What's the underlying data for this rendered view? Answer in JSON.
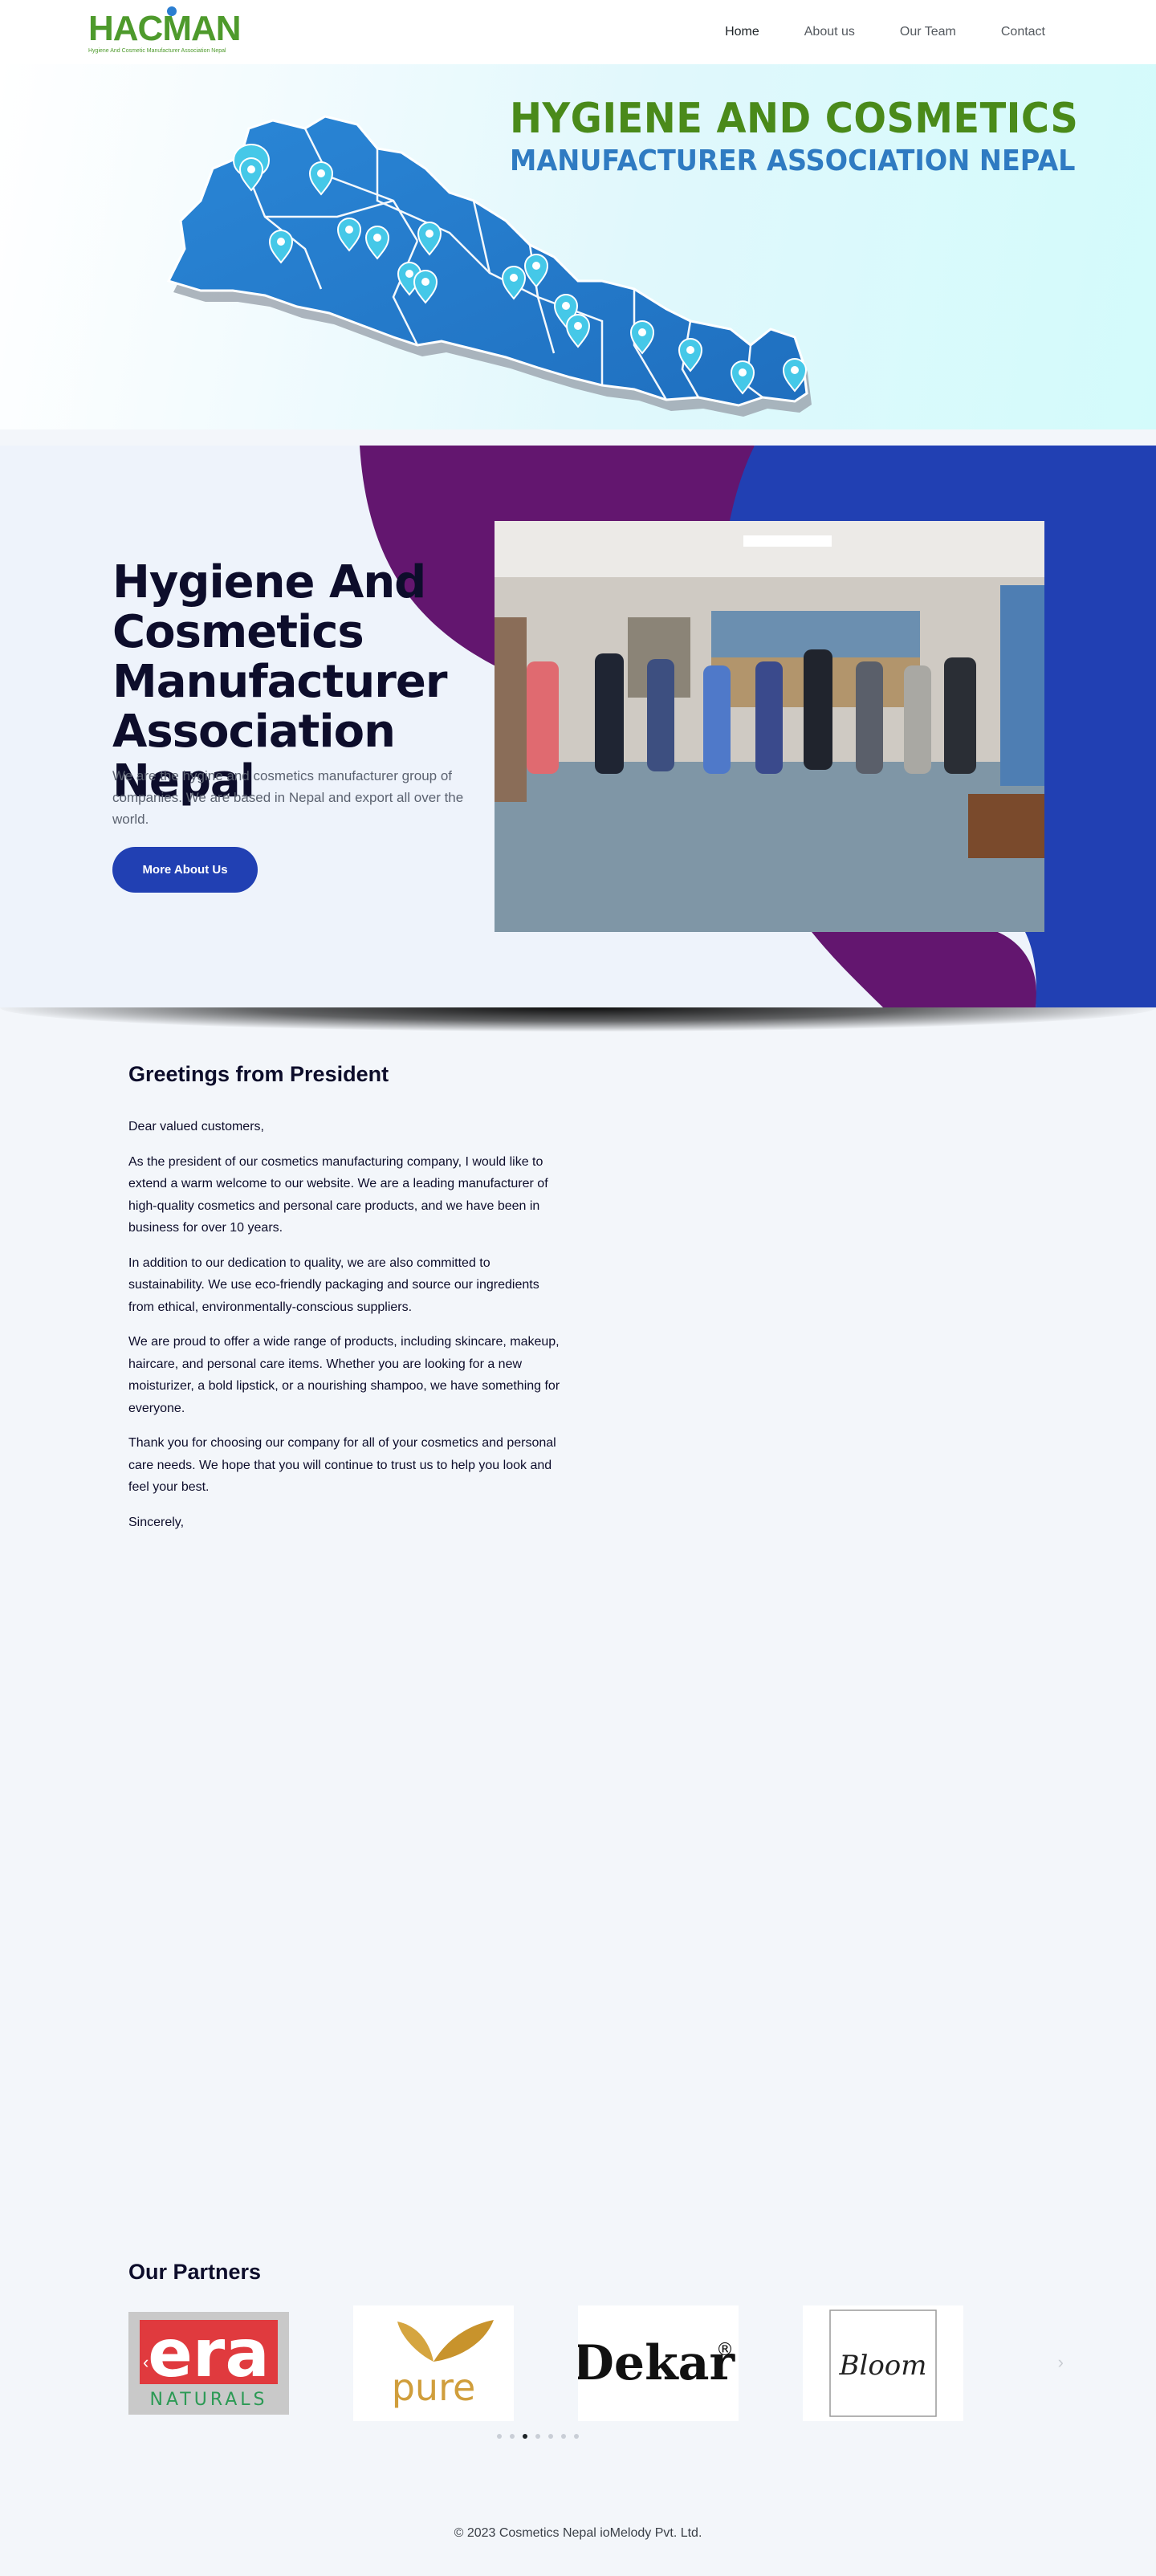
{
  "header": {
    "logo_text": "HACMAN",
    "logo_subtext": "Hygiene And Cosmetic Manufacturer Association Nepal",
    "nav": [
      {
        "label": "Home",
        "active": true
      },
      {
        "label": "About us",
        "active": false
      },
      {
        "label": "Our Team",
        "active": false
      },
      {
        "label": "Contact",
        "active": false
      }
    ]
  },
  "banner": {
    "title": "HYGIENE AND COSMETICS",
    "subtitle": "MANUFACTURER ASSOCIATION NEPAL",
    "map_color": "#2981cf",
    "pin_color": "#3fc7e6",
    "title_color": "#4a8a1a",
    "subtitle_color": "#2f7bc2"
  },
  "hero": {
    "title": "Hygiene And Cosmetics Manufacturer Association Nepal",
    "description": "We are the hygine and cosmetics manufacturer group of companies. We are based in Nepal and export all over the world.",
    "button_label": "More About Us",
    "colors": {
      "purple": "#63166f",
      "blue": "#2140b3",
      "bg": "#eef3fb"
    }
  },
  "greetings": {
    "heading": "Greetings from President",
    "paragraphs": [
      "Dear valued customers,",
      "As the president of our cosmetics manufacturing company, I would like to extend a warm welcome to our website. We are a leading manufacturer of high-quality cosmetics and personal care products, and we have been in business for over 10 years.",
      "In addition to our dedication to quality, we are also committed to sustainability. We use eco-friendly packaging and source our ingredients from ethical, environmentally-conscious suppliers.",
      "We are proud to offer a wide range of products, including skincare, makeup, haircare, and personal care items. Whether you are looking for a new moisturizer, a bold lipstick, or a nourishing shampoo, we have something for everyone.",
      "Thank you for choosing our company for all of your cosmetics and personal care needs. We hope that you will continue to trust us to help you look and feel your best.",
      "Sincerely,"
    ]
  },
  "partners": {
    "heading": "Our Partners",
    "logos": [
      {
        "name": "era",
        "subtext": "NATURALS"
      },
      {
        "name": "pure"
      },
      {
        "name": "Dekar",
        "mark": "®"
      },
      {
        "name": "Bloom"
      }
    ],
    "prev_icon": "‹",
    "next_icon": "›",
    "dots_count": 7,
    "active_dot": 3
  },
  "footer": {
    "copyright": "© 2023 Cosmetics Nepal ioMelody Pvt. Ltd."
  }
}
